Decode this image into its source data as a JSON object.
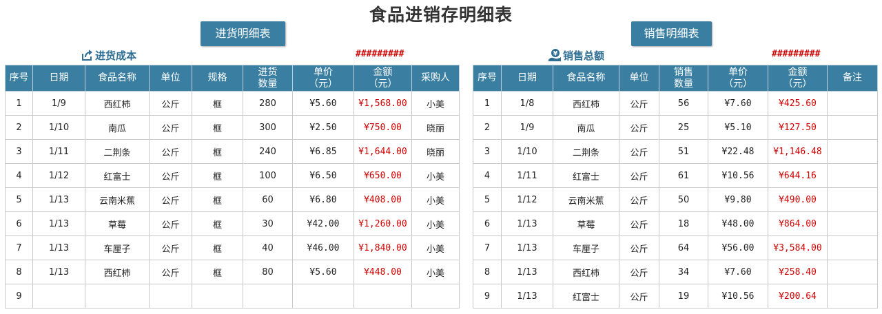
{
  "title": "食品进销存明细表",
  "purchase": {
    "button_label": "进货明细表",
    "summary_label": "进货成本",
    "summary_value": "#########",
    "headers": [
      "序号",
      "日期",
      "食品名称",
      "单位",
      "规格",
      "进货\n数量",
      "单价\n（元）",
      "金额\n（元）",
      "采购人"
    ],
    "rows": [
      [
        "1",
        "1/9",
        "西红柿",
        "公斤",
        "框",
        "280",
        "¥5.60",
        "¥1,568.00",
        "小美"
      ],
      [
        "2",
        "1/10",
        "南瓜",
        "公斤",
        "框",
        "300",
        "¥2.50",
        "¥750.00",
        "晓丽"
      ],
      [
        "3",
        "1/11",
        "二荆条",
        "公斤",
        "框",
        "240",
        "¥6.85",
        "¥1,644.00",
        "晓丽"
      ],
      [
        "4",
        "1/12",
        "红富士",
        "公斤",
        "框",
        "100",
        "¥6.50",
        "¥650.00",
        "小美"
      ],
      [
        "5",
        "1/13",
        "云南米蕉",
        "公斤",
        "框",
        "60",
        "¥6.80",
        "¥408.00",
        "小美"
      ],
      [
        "6",
        "1/13",
        "草莓",
        "公斤",
        "框",
        "30",
        "¥42.00",
        "¥1,260.00",
        "小美"
      ],
      [
        "7",
        "1/13",
        "车厘子",
        "公斤",
        "框",
        "40",
        "¥46.00",
        "¥1,840.00",
        "小美"
      ],
      [
        "8",
        "1/13",
        "西红柿",
        "公斤",
        "框",
        "80",
        "¥5.60",
        "¥448.00",
        "小美"
      ],
      [
        "9",
        "",
        "",
        "",
        "",
        "",
        "",
        "",
        ""
      ]
    ]
  },
  "sales": {
    "button_label": "销售明细表",
    "summary_label": "销售总额",
    "summary_value": "#########",
    "headers": [
      "序号",
      "日期",
      "食品名称",
      "单位",
      "销售\n数量",
      "单价\n（元）",
      "金额\n（元）",
      "备注"
    ],
    "rows": [
      [
        "1",
        "1/8",
        "西红柿",
        "公斤",
        "56",
        "¥7.60",
        "¥425.60",
        ""
      ],
      [
        "2",
        "1/9",
        "南瓜",
        "公斤",
        "25",
        "¥5.10",
        "¥127.50",
        ""
      ],
      [
        "3",
        "1/10",
        "二荆条",
        "公斤",
        "51",
        "¥22.48",
        "¥1,146.48",
        ""
      ],
      [
        "4",
        "1/11",
        "红富士",
        "公斤",
        "61",
        "¥10.56",
        "¥644.16",
        ""
      ],
      [
        "5",
        "1/12",
        "云南米蕉",
        "公斤",
        "50",
        "¥9.80",
        "¥490.00",
        ""
      ],
      [
        "6",
        "1/13",
        "草莓",
        "公斤",
        "18",
        "¥48.00",
        "¥864.00",
        ""
      ],
      [
        "7",
        "1/13",
        "车厘子",
        "公斤",
        "64",
        "¥56.00",
        "¥3,584.00",
        ""
      ],
      [
        "8",
        "1/13",
        "西红柿",
        "公斤",
        "34",
        "¥7.60",
        "¥258.40",
        ""
      ],
      [
        "9",
        "1/13",
        "红富士",
        "公斤",
        "19",
        "¥10.56",
        "¥200.64",
        ""
      ]
    ]
  },
  "colors": {
    "header_bg": "#3a7fa2",
    "amount_red": "#d00000",
    "label_blue": "#2f6f94"
  },
  "icons": {
    "purchase_summary": "export-arrow-icon",
    "sales_summary": "yen-coin-bag-icon"
  }
}
